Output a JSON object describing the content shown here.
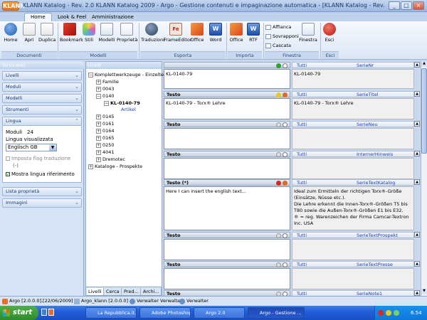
{
  "window": {
    "app_badge": "KLANN",
    "title": "KLANN Katalog - Rev. 2.0 KLANN Katalog 2009 - Argo - Gestione contenuti e impaginazione automatica - [KLANN Katalog - Rev. 2.0 KLANN Katalog",
    "buttons": [
      "_",
      "□",
      "×"
    ]
  },
  "ribbon_tabs": [
    "Home",
    "Look & Feel",
    "Amministrazione"
  ],
  "ribbon": {
    "groups": {
      "documenti": "Documenti",
      "modelli": "Modelli",
      "esporta": "Esporta",
      "importa": "Importa",
      "finestra": "Finestra",
      "esci": "Esci"
    },
    "buttons": {
      "home": "Home",
      "apri": "Apri",
      "duplica": "Duplica",
      "bookmark": "Bookmark",
      "stili": "Stili",
      "modelli": "Modelli",
      "proprieta": "Proprietà",
      "traduzioni": "Traduzioni",
      "frameeditor": "FrameEditor",
      "office": "Office",
      "word": "Word",
      "office_imp": "Office",
      "rtf": "RTF",
      "affianca": "Affianca",
      "sovrapponi": "Sovrapponi",
      "cascata": "Cascata",
      "finestra": "Finestra",
      "esci": "Esci"
    }
  },
  "left": {
    "header": "Strumenti",
    "panes": [
      "Livelli",
      "Moduli",
      "Modelli",
      "Strumenti",
      "Lingua"
    ],
    "lingua": {
      "moduli_label": "Moduli",
      "moduli_count": "24",
      "lingua_label": "Lingua visualizzata",
      "selected": "Englisch GB",
      "imposta_flag": "Imposta flag traduzione",
      "placeholder": "(-)",
      "mostra": "Mostra lingua riferimento"
    },
    "bottom_panes": [
      "Lista proprietà",
      "Immagini"
    ]
  },
  "tree": {
    "header": "Livelli",
    "nodes": {
      "root": "Komplettwerkzeuge - Einzelteile",
      "familie": "Familie",
      "n0043": "0043",
      "n0140": "0140",
      "kl": "KL-0140-79",
      "artikel": "Artikel",
      "n0145": "0145",
      "n0161": "0161",
      "n0164": "0164",
      "n0165": "0165",
      "n0250": "0250",
      "n4041": "4041",
      "dremotec": "Dremotec",
      "kataloge": "Kataloge - Prospekte"
    },
    "tabs": [
      "Livelli",
      "Cerca",
      "Pred...",
      "Archi..."
    ]
  },
  "fields": [
    {
      "label": "",
      "value": "KL-0140-79",
      "ref": "KL-0140-79",
      "scope": "Tutti",
      "serie": "SerieNr"
    },
    {
      "label": "Testo",
      "value": "KL-0140-79 - Torx® Lehre",
      "ref": "KL-0140-79 - Torx® Lehre",
      "scope": "Tutti",
      "serie": "SerieTitel"
    },
    {
      "label": "Testo",
      "value": "",
      "ref": "",
      "scope": "Tutti",
      "serie": "SerieNeu"
    },
    {
      "label": "Testo",
      "value": "",
      "ref": "",
      "scope": "Tutti",
      "serie": "InternerHinweis"
    },
    {
      "label": "Testo (*)",
      "value": "Here I can insert the english text...",
      "ref": "Ideal zum Ermitteln der richtigen Torx®-Größe (Einsätze, Nüsse etc.).\nDie Lehre erkennt die Innen-Torx®-Größen T5 bis T80 sowie die Außen-Torx®-Größen E1 bis E32.\n® = reg. Warenzeichen der Firma Camcar-Textron Inc. USA",
      "scope": "Tutti",
      "serie": "SerieTextKatalog"
    },
    {
      "label": "Testo",
      "value": "",
      "ref": "",
      "scope": "Tutti",
      "serie": "SerieTextProspekt"
    },
    {
      "label": "Testo",
      "value": "",
      "ref": "",
      "scope": "Tutti",
      "serie": "SerieTextPresse"
    },
    {
      "label": "Testo",
      "value": "",
      "ref": "",
      "scope": "Tutti",
      "serie": "SerieNote1"
    }
  ],
  "status": {
    "items": [
      "Argo  [2.0.0.0],[22/06/2009]",
      "Argo_klann [2.0.0.0]",
      "Verwalter Verwalter",
      "Verwalter"
    ]
  },
  "taskbar": {
    "start": "start",
    "tasks": [
      "La Repubblica.it...",
      "Adobe Photoshop",
      "Argo 2.0",
      "Argo - Gestione ..."
    ],
    "clock": "6.54"
  },
  "colors": {
    "accent": "#1c3fae",
    "ribbon_bg": "#dbe6f5",
    "taskbar": "#245edb",
    "start": "#2d8b2a"
  }
}
